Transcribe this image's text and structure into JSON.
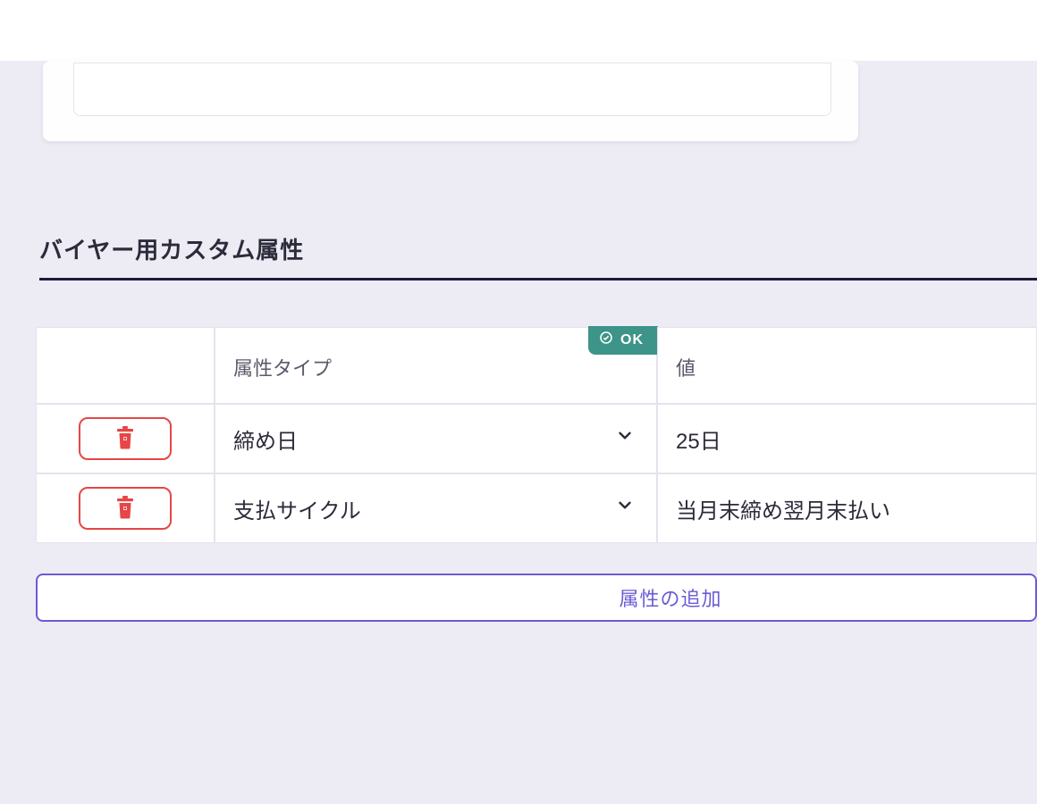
{
  "section": {
    "title": "バイヤー用カスタム属性"
  },
  "table": {
    "headers": {
      "type": "属性タイプ",
      "value": "値"
    },
    "ok_label": "OK",
    "rows": [
      {
        "type": "締め日",
        "value": "25日"
      },
      {
        "type": "支払サイクル",
        "value": "当月末締め翌月末払い"
      }
    ]
  },
  "buttons": {
    "add_attribute": "属性の追加"
  }
}
